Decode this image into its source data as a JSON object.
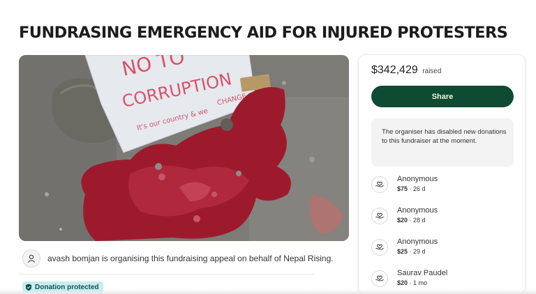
{
  "page": {
    "title": "FUNDRASING EMERGENCY AID FOR INJURED PROTESTERS"
  },
  "hero": {
    "sign_text_line1": "NO TO",
    "sign_text_line2": "CORRUPTION",
    "sign_text_line3": "It's our country & we",
    "sign_text_line4": "CHANGE"
  },
  "organiser": {
    "text": "avash bomjan is organising this fundraising appeal on behalf of Nepal Rising."
  },
  "badge": {
    "label": "Donation protected"
  },
  "card": {
    "amount": "$342,429",
    "raised_label": "raised",
    "share_label": "Share",
    "notice": "The organiser has disabled new donations to this fundraiser at the moment.",
    "donations": [
      {
        "name": "Anonymous",
        "amount": "$75",
        "time": " · 26 d"
      },
      {
        "name": "Anonymous",
        "amount": "$20",
        "time": " · 28 d"
      },
      {
        "name": "Anonymous",
        "amount": "$25",
        "time": " · 29 d"
      },
      {
        "name": "Saurav Paudel",
        "amount": "$20",
        "time": " · 1 mo"
      }
    ]
  },
  "colors": {
    "share_button": "#0f4a33",
    "badge_bg": "#c7eef0",
    "notice_bg": "#f3f3f3"
  },
  "icons": {
    "avatar": "user-icon",
    "badge": "shield-icon",
    "donation": "donation-hand-heart-icon"
  }
}
